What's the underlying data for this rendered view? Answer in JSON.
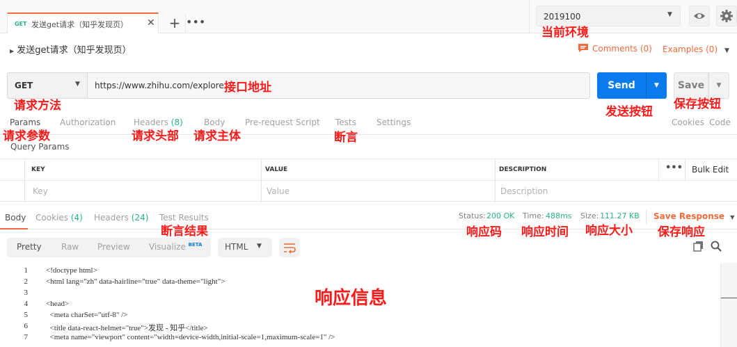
{
  "tab": {
    "method": "GET",
    "name": "发送get请求（知乎发现页）",
    "close_symbol": "✕",
    "new_tab_symbol": "+",
    "more_symbol": "•••"
  },
  "environment": {
    "selected": "2019100"
  },
  "request": {
    "name": "发送get请求（知乎发现页）",
    "comments_label": "Comments (0)",
    "examples_label": "Examples (0)",
    "method": "GET",
    "url": "https://www.zhihu.com/explore",
    "send_label": "Send",
    "save_label": "Save"
  },
  "request_tabs": {
    "params": "Params",
    "authorization": "Authorization",
    "headers": "Headers",
    "headers_count": "(8)",
    "body": "Body",
    "prerequest": "Pre-request Script",
    "tests": "Tests",
    "settings": "Settings",
    "cookies": "Cookies",
    "code": "Code"
  },
  "query_params": {
    "title": "Query Params",
    "columns": [
      "KEY",
      "VALUE",
      "DESCRIPTION"
    ],
    "more_symbol": "•••",
    "bulk_edit": "Bulk Edit",
    "placeholders": [
      "Key",
      "Value",
      "Description"
    ]
  },
  "response_tabs": {
    "body": "Body",
    "cookies": "Cookies",
    "cookies_count": "(4)",
    "headers": "Headers",
    "headers_count": "(24)",
    "test_results": "Test Results"
  },
  "response_meta": {
    "status_label": "Status:",
    "status_value": "200 OK",
    "time_label": "Time:",
    "time_value": "488ms",
    "size_label": "Size:",
    "size_value": "111.27 KB",
    "save_response": "Save Response"
  },
  "response_view": {
    "modes": [
      "Pretty",
      "Raw",
      "Preview",
      "Visualize"
    ],
    "beta": "BETA",
    "format": "HTML"
  },
  "code_lines": [
    {
      "n": "1",
      "t": "<!doctype html>"
    },
    {
      "n": "2",
      "t": "<html lang=\"zh\" data-hairline=\"true\" data-theme=\"light\">"
    },
    {
      "n": "3",
      "t": ""
    },
    {
      "n": "4",
      "t": "<head>"
    },
    {
      "n": "5",
      "t": "  <meta charSet=\"utf-8\" />"
    },
    {
      "n": "6",
      "t": "  <title data-react-helmet=\"true\">发现 - 知乎</title>"
    },
    {
      "n": "7",
      "t": "  <meta name=\"viewport\" content=\"width=device-width,initial-scale=1,maximum-scale=1\" />"
    }
  ],
  "annotations": {
    "env": "当前环境",
    "method": "请求方法",
    "url": "接口地址",
    "send": "发送按钮",
    "save": "保存按钮",
    "params": "请求参数",
    "headers": "请求头部",
    "body": "请求主体",
    "tests": "断言",
    "test_results": "断言结果",
    "status": "响应码",
    "time": "响应时间",
    "size": "响应大小",
    "save_response": "保存响应",
    "response": "响应信息"
  },
  "colors": {
    "accent": "#f26b3a",
    "send": "#097bed",
    "status_ok": "#26b47f",
    "annotation": "#ff1a1a"
  }
}
